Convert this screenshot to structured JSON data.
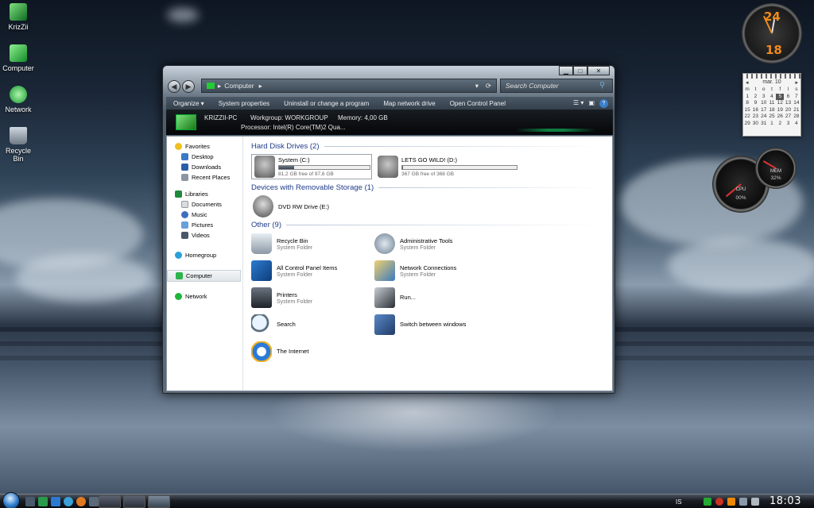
{
  "desktop": {
    "icons": [
      {
        "label": "KrizZii",
        "icon": "user-folder-icon",
        "color": "#2aa84a"
      },
      {
        "label": "Computer",
        "icon": "computer-icon",
        "color": "#33c24a"
      },
      {
        "label": "Network",
        "icon": "network-icon",
        "color": "#1fb53a"
      },
      {
        "label": "Recycle Bin",
        "icon": "recycle-bin-icon",
        "color": "#8e9aa6"
      }
    ]
  },
  "gadgets": {
    "clock": {
      "top_num": "24",
      "bottom_num": "18"
    },
    "calendar": {
      "month": "mar. 10",
      "weeks": [
        [
          "m",
          "t",
          "o",
          "t",
          "f",
          "l",
          "s"
        ],
        [
          "",
          "",
          "",
          "",
          "",
          "",
          ""
        ],
        [
          "1",
          "2",
          "3",
          "4",
          "5",
          "6",
          "7"
        ],
        [
          "8",
          "9",
          "10",
          "11",
          "12",
          "13",
          "14"
        ],
        [
          "15",
          "16",
          "17",
          "18",
          "19",
          "20",
          "21"
        ],
        [
          "22",
          "23",
          "24",
          "25",
          "26",
          "27",
          "28"
        ],
        [
          "29",
          "30",
          "31",
          "1",
          "2",
          "3",
          "4"
        ]
      ],
      "today": "5"
    },
    "cpu_meter": {
      "label": "CPU",
      "value": "00%"
    },
    "ram_meter": {
      "label": "MEM",
      "value": "32%"
    }
  },
  "window": {
    "address": "Computer",
    "search_placeholder": "Search Computer",
    "toolbar": [
      "Organize ▾",
      "System properties",
      "Uninstall or change a program",
      "Map network drive",
      "Open Control Panel"
    ],
    "details": {
      "pc_name": "KRIZZII-PC",
      "workgroup": "Workgroup: WORKGROUP",
      "memory": "Memory: 4,00 GB",
      "processor": "Processor: Intel(R) Core(TM)2 Qua..."
    },
    "nav": {
      "favorites": {
        "label": "Favorites",
        "items": [
          "Desktop",
          "Downloads",
          "Recent Places"
        ]
      },
      "libraries": {
        "label": "Libraries",
        "items": [
          "Documents",
          "Music",
          "Pictures",
          "Videos"
        ]
      },
      "homegroup": "Homegroup",
      "computer": "Computer",
      "network": "Network"
    },
    "sections": {
      "hard_disks": "Hard Disk Drives (2)",
      "removable": "Devices with Removable Storage (1)",
      "other": "Other (9)"
    },
    "drives": [
      {
        "name": "System (C:)",
        "free": "81,2 GB free of 97,6 GB",
        "used_fraction": 0.17
      },
      {
        "name": "LETS GO WILD! (D:)",
        "free": "367 GB free of 368 GB",
        "used_fraction": 0.003
      }
    ],
    "removable_drive": "DVD RW Drive (E:)",
    "others": [
      {
        "name": "Recycle Bin",
        "sub": "System Folder",
        "icon": "recycle-bin-icon"
      },
      {
        "name": "Administrative Tools",
        "sub": "System Folder",
        "icon": "admin-tools-icon"
      },
      {
        "name": "All Control Panel Items",
        "sub": "System Folder",
        "icon": "control-panel-icon"
      },
      {
        "name": "Network Connections",
        "sub": "System Folder",
        "icon": "network-connections-icon"
      },
      {
        "name": "Printers",
        "sub": "System Folder",
        "icon": "printer-icon"
      },
      {
        "name": "Run...",
        "sub": "",
        "icon": "run-icon"
      },
      {
        "name": "Search",
        "sub": "",
        "icon": "search-icon"
      },
      {
        "name": "Switch between windows",
        "sub": "",
        "icon": "switch-windows-icon"
      },
      {
        "name": "The Internet",
        "sub": "",
        "icon": "internet-explorer-icon"
      }
    ]
  },
  "taskbar": {
    "language": "IS",
    "time": "18:03"
  },
  "colors": {
    "section_title": "#1e3b8a",
    "accent_green": "#1fb53a"
  }
}
